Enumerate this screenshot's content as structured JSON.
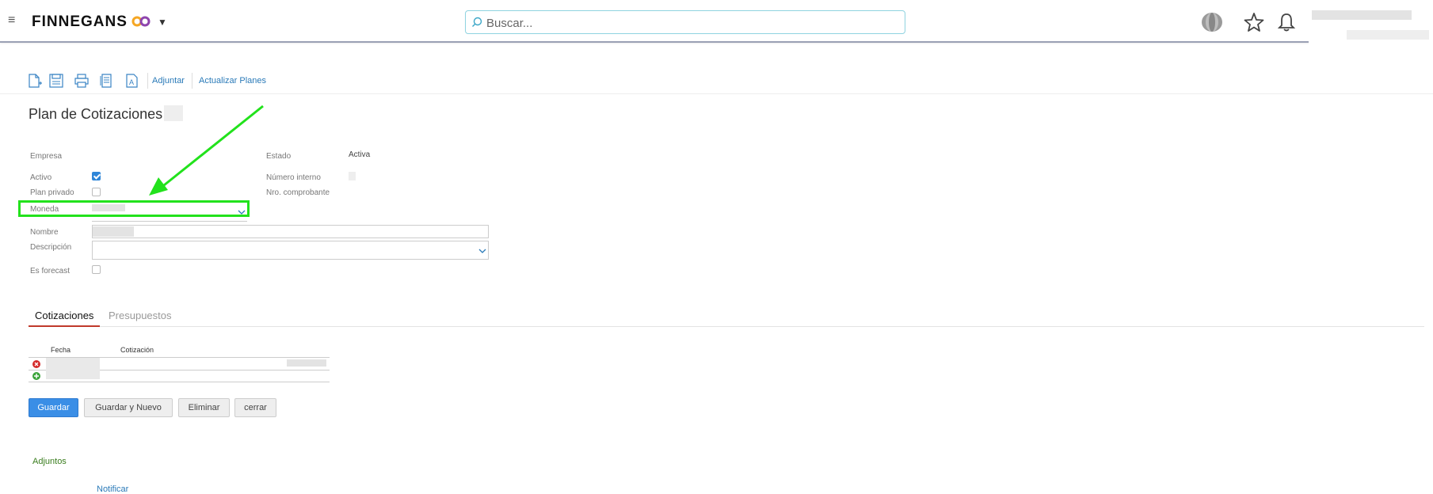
{
  "header": {
    "brand": "FINNEGANS",
    "search_placeholder": "Buscar..."
  },
  "toolbar": {
    "icons": [
      "new-document-icon",
      "save-icon",
      "print-icon",
      "copy-document-icon",
      "export-icon"
    ],
    "adjuntar": "Adjuntar",
    "actualizar": "Actualizar Planes"
  },
  "page": {
    "title": "Plan de Cotizaciones"
  },
  "form": {
    "empresa_label": "Empresa",
    "activo_label": "Activo",
    "plan_privado_label": "Plan privado",
    "moneda_label": "Moneda",
    "nombre_label": "Nombre",
    "descripcion_label": "Descripción",
    "es_forecast_label": "Es forecast",
    "estado_label": "Estado",
    "estado_value": "Activa",
    "numero_interno_label": "Número interno",
    "nro_comprobante_label": "Nro. comprobante",
    "activo_checked": true,
    "plan_privado_checked": false,
    "es_forecast_checked": false
  },
  "tabs": {
    "cotizaciones": "Cotizaciones",
    "presupuestos": "Presupuestos"
  },
  "grid": {
    "col_fecha": "Fecha",
    "col_cotizacion": "Cotización"
  },
  "buttons": {
    "guardar": "Guardar",
    "guardar_nuevo": "Guardar y Nuevo",
    "eliminar": "Eliminar",
    "cerrar": "cerrar"
  },
  "adjuntos": {
    "title": "Adjuntos",
    "notificar": "Notificar"
  },
  "colors": {
    "accent": "#3a8ee6",
    "highlight": "#22e21c",
    "arrow": "#22e21c"
  }
}
